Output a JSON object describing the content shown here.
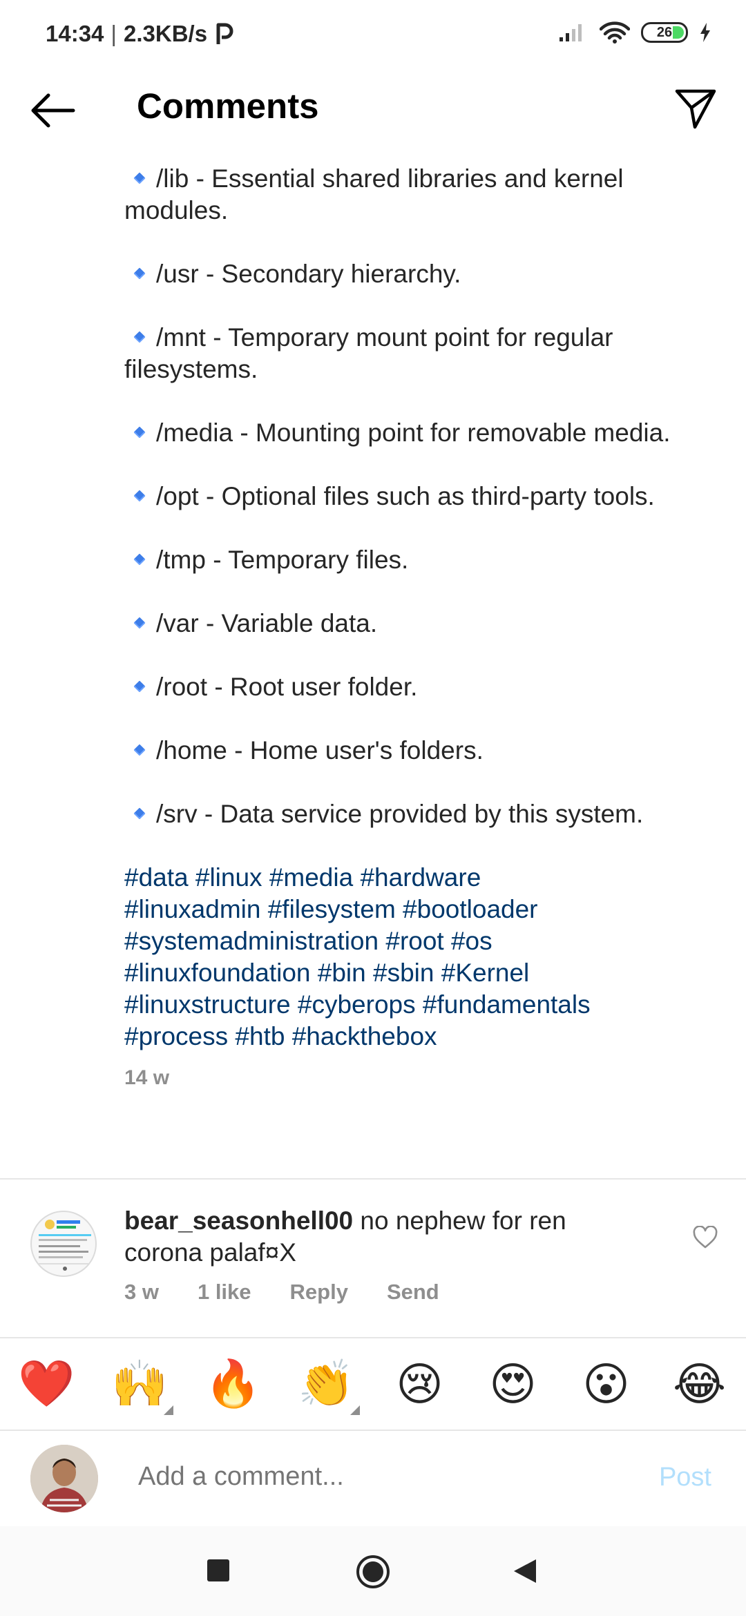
{
  "status_bar": {
    "time": "14:34",
    "separator": "|",
    "speed": "2.3KB/s",
    "battery": "26"
  },
  "header": {
    "title": "Comments"
  },
  "caption": {
    "items": [
      "/lib - Essential shared libraries and kernel modules.",
      "/usr - Secondary hierarchy.",
      "/mnt - Temporary mount point for regular filesystems.",
      "/media - Mounting point for removable media.",
      "/opt - Optional files such as third-party tools.",
      "/tmp - Temporary files.",
      "/var - Variable data.",
      "/root - Root user folder.",
      "/home - Home user's folders.",
      "/srv - Data service provided by this system."
    ],
    "hashtags": [
      "#data #linux #media #hardware",
      "#linuxadmin #filesystem #bootloader",
      "#systemadministration #root #os",
      "#linuxfoundation #bin #sbin #Kernel",
      "#linuxstructure #cyberops #fundamentals",
      "#process #htb #hackthebox"
    ],
    "timestamp": "14 w"
  },
  "comment": {
    "username": "bear_seasonhell00",
    "text": " no nephew for ren corona palaf¤X",
    "time": "3 w",
    "likes": "1 like",
    "reply": "Reply",
    "send": "Send"
  },
  "emoji_bar": [
    "❤️",
    "🙌",
    "🔥",
    "👏",
    "😢",
    "😍",
    "😮",
    "😂"
  ],
  "composer": {
    "placeholder": "Add a comment...",
    "post_label": "Post"
  },
  "colors": {
    "hashtag": "#00376b",
    "muted": "#8e8e8e",
    "post_disabled": "#b2dffc",
    "bullet": "#3d7de8"
  }
}
